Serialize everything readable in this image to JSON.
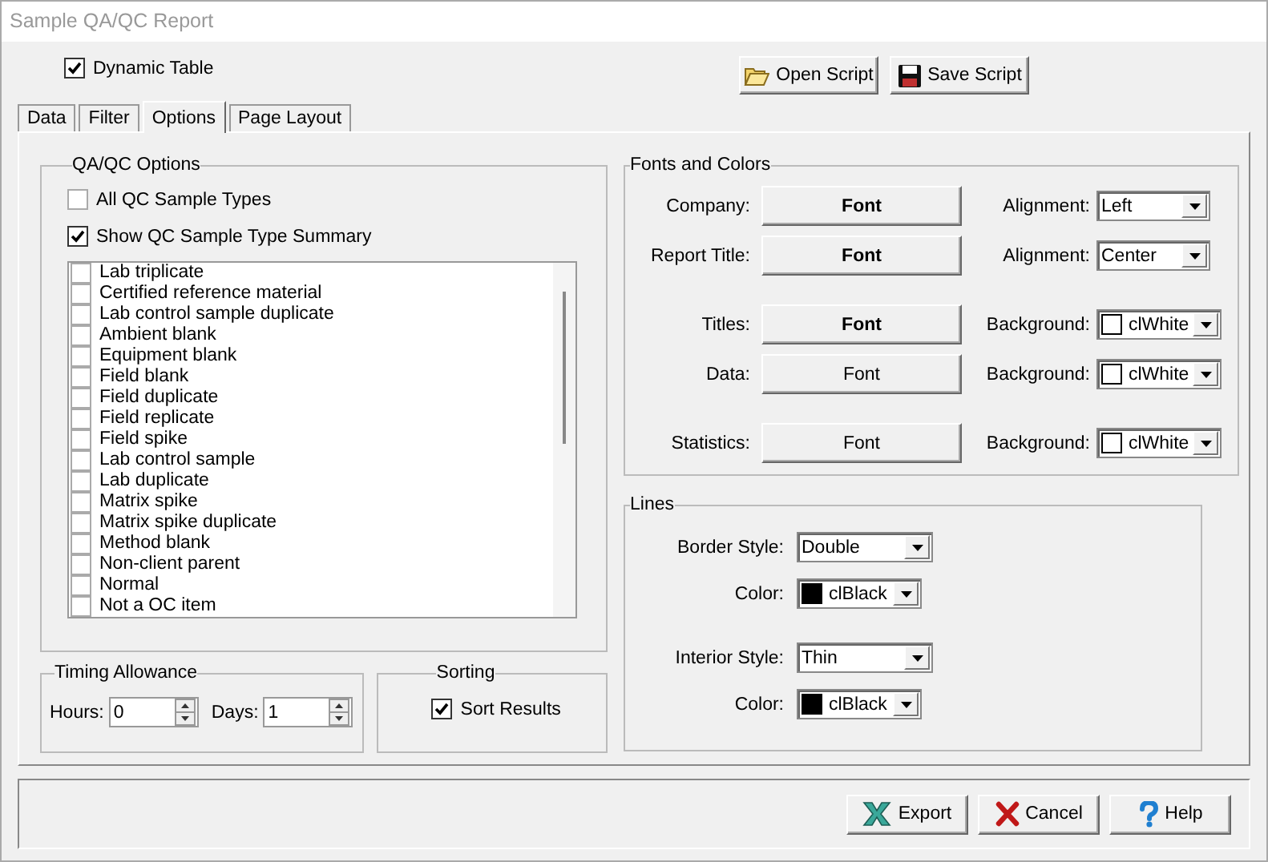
{
  "window": {
    "title": "Sample QA/QC Report"
  },
  "dynamic_table": {
    "label": "Dynamic Table",
    "checked": true
  },
  "toolbar_buttons": [
    {
      "label": "Open Script",
      "kind": "open"
    },
    {
      "label": "Save Script",
      "kind": "save"
    }
  ],
  "tabs": [
    {
      "label": "Data",
      "selected": false
    },
    {
      "label": "Filter",
      "selected": false
    },
    {
      "label": "Options",
      "selected": true
    },
    {
      "label": "Page Layout",
      "selected": false
    }
  ],
  "qaqc_options": {
    "title": "QA/QC Options",
    "checkboxes": [
      {
        "label": "All QC Sample Types",
        "checked": false
      },
      {
        "label": "Show QC Sample Type Summary",
        "checked": true
      }
    ],
    "sample_types": [
      {
        "label": "Lab triplicate",
        "checked": false
      },
      {
        "label": "Certified reference material",
        "checked": false
      },
      {
        "label": "Lab control sample duplicate",
        "checked": false
      },
      {
        "label": "Ambient blank",
        "checked": false
      },
      {
        "label": "Equipment blank",
        "checked": false
      },
      {
        "label": "Field blank",
        "checked": false
      },
      {
        "label": "Field duplicate",
        "checked": false
      },
      {
        "label": "Field replicate",
        "checked": false
      },
      {
        "label": "Field spike",
        "checked": false
      },
      {
        "label": "Lab control sample",
        "checked": false
      },
      {
        "label": "Lab duplicate",
        "checked": false
      },
      {
        "label": "Matrix spike",
        "checked": false
      },
      {
        "label": "Matrix spike duplicate",
        "checked": false
      },
      {
        "label": "Method blank",
        "checked": false
      },
      {
        "label": "Non-client parent",
        "checked": false
      },
      {
        "label": "Normal",
        "checked": false
      },
      {
        "label": "Not a OC item",
        "checked": false
      }
    ]
  },
  "timing_allowance": {
    "title": "Timing Allowance",
    "fields": [
      {
        "label": "Hours:",
        "value": "0"
      },
      {
        "label": "Days:",
        "value": "1"
      }
    ]
  },
  "sorting": {
    "title": "Sorting",
    "sort_results": {
      "label": "Sort Results",
      "checked": true
    }
  },
  "fonts_and_colors": {
    "title": "Fonts and Colors",
    "groups": [
      [
        {
          "label": "Company:",
          "button": "Font",
          "bold": true,
          "kind": "alignment",
          "setting_label": "Alignment:",
          "value": "Left"
        },
        {
          "label": "Report Title:",
          "button": "Font",
          "bold": true,
          "kind": "alignment",
          "setting_label": "Alignment:",
          "value": "Center"
        }
      ],
      [
        {
          "label": "Titles:",
          "button": "Font",
          "bold": true,
          "kind": "background",
          "setting_label": "Background:",
          "value": "clWhite",
          "color": "#ffffff"
        },
        {
          "label": "Data:",
          "button": "Font",
          "bold": false,
          "kind": "background",
          "setting_label": "Background:",
          "value": "clWhite",
          "color": "#ffffff"
        }
      ],
      [
        {
          "label": "Statistics:",
          "button": "Font",
          "bold": false,
          "kind": "background",
          "setting_label": "Background:",
          "value": "clWhite",
          "color": "#ffffff"
        }
      ]
    ]
  },
  "lines": {
    "title": "Lines",
    "groups": [
      [
        {
          "label": "Border Style:",
          "kind": "style",
          "value": "Double"
        },
        {
          "label": "Color:",
          "kind": "color",
          "value": "clBlack",
          "color": "#000000"
        }
      ],
      [
        {
          "label": "Interior Style:",
          "kind": "style",
          "value": "Thin"
        },
        {
          "label": "Color:",
          "kind": "color",
          "value": "clBlack",
          "color": "#000000"
        }
      ]
    ]
  },
  "buttons": [
    {
      "label": "Export",
      "kind": "export"
    },
    {
      "label": "Cancel",
      "kind": "cancel"
    },
    {
      "label": "Help",
      "kind": "help"
    }
  ]
}
